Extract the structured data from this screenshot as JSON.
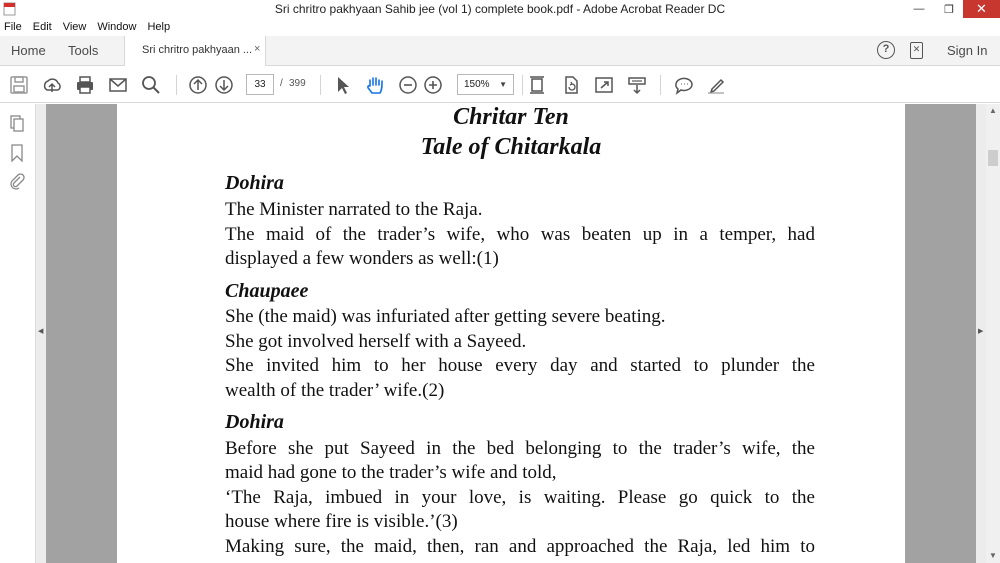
{
  "window": {
    "title": "Sri chritro pakhyaan Sahib jee (vol 1) complete book.pdf - Adobe Acrobat Reader DC"
  },
  "menu": [
    "File",
    "Edit",
    "View",
    "Window",
    "Help"
  ],
  "tabs": {
    "home": "Home",
    "tools": "Tools",
    "document_tab": "Sri chritro pakhyaan ...",
    "close_glyph": "×",
    "sign_in": "Sign In"
  },
  "toolbar": {
    "current_page": "33",
    "page_separator": "/",
    "total_pages": "399",
    "zoom": "150%"
  },
  "icons": {
    "toolbar": [
      "save-icon",
      "upload-icon",
      "print-icon",
      "email-icon",
      "search-icon",
      "page-up-icon",
      "page-down-icon",
      "select-arrow-icon",
      "hand-tool-icon",
      "zoom-out-icon",
      "zoom-in-icon",
      "fit-page-icon",
      "rotate-icon",
      "fullscreen-icon",
      "scroll-mode-icon",
      "comment-icon",
      "sign-icon"
    ],
    "sidebar": [
      "pages-icon",
      "bookmark-icon",
      "attachment-icon"
    ]
  },
  "document": {
    "title_line1": "Chritar Ten",
    "title_line2": "Tale of Chitarkala",
    "sections": [
      {
        "heading": "Dohira",
        "lines": [
          "The Minister narrated to the Raja.",
          "The maid of the trader’s wife, who was beaten up in a temper, had",
          "displayed a few wonders as well:(1)"
        ]
      },
      {
        "heading": "Chaupaee",
        "lines": [
          "She (the maid) was infuriated after getting severe beating.",
          "She got involved herself with a Sayeed.",
          "She invited him to her house every day and started to plunder the",
          "wealth of the trader’ wife.(2)"
        ]
      },
      {
        "heading": "Dohira",
        "lines": [
          "Before she put Sayeed in the bed belonging to the trader’s wife, the",
          "maid had gone to the trader’s wife and told,",
          "‘The Raja, imbued in your love, is waiting. Please go quick to the",
          "house where fire is visible.’(3)",
          "Making sure, the maid, then, ran and approached the Raja, led him to"
        ]
      }
    ]
  },
  "colors": {
    "close_button": "#c7372f",
    "doc_background": "#a2a2a2",
    "hand_tool_active": "#1473e6"
  }
}
